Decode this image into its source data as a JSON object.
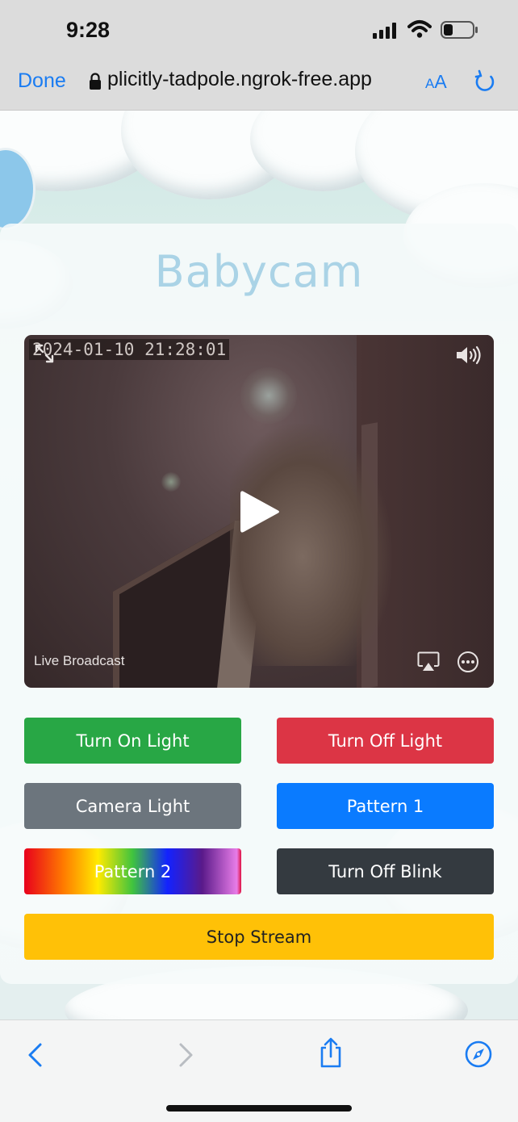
{
  "status_bar": {
    "time": "9:28",
    "icons": [
      "cellular-signal-icon",
      "wifi-icon",
      "battery-icon"
    ]
  },
  "browser": {
    "done_label": "Done",
    "url": "plicitly-tadpole.ngrok-free.app",
    "text_size_small": "A",
    "text_size_big": "A",
    "accent_color": "#1a7cf2"
  },
  "page": {
    "title": "Babycam",
    "title_color": "#aad3e6"
  },
  "video": {
    "timestamp": "2024-01-10 21:28:01",
    "live_label": "Live Broadcast",
    "controls": [
      "expand-icon",
      "volume-icon",
      "play-icon",
      "airplay-icon",
      "more-icon"
    ]
  },
  "buttons": {
    "turn_on_light": "Turn On Light",
    "turn_off_light": "Turn Off Light",
    "camera_light": "Camera Light",
    "pattern_1": "Pattern 1",
    "pattern_2": "Pattern 2",
    "turn_off_blink": "Turn Off Blink",
    "stop_stream": "Stop Stream"
  },
  "colors": {
    "green": "#28a745",
    "red": "#dc3545",
    "gray": "#6c757d",
    "blue": "#0a7bff",
    "dark": "#343a40",
    "yellow": "#ffc107"
  },
  "toolbar": {
    "icons": [
      "back-icon",
      "forward-icon",
      "share-icon",
      "compass-icon"
    ]
  }
}
